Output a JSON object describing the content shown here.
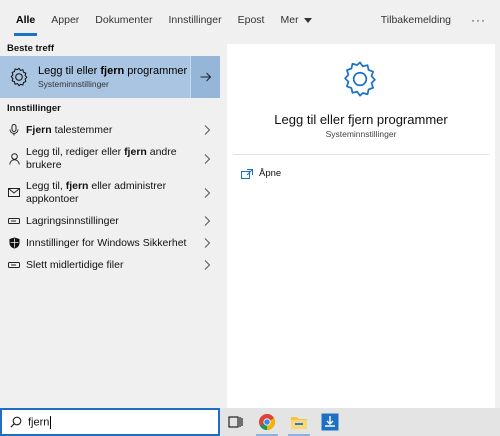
{
  "tabs": [
    {
      "label": "Alle",
      "active": true
    },
    {
      "label": "Apper"
    },
    {
      "label": "Dokumenter"
    },
    {
      "label": "Innstillinger"
    },
    {
      "label": "Epost"
    },
    {
      "label": "Mer"
    }
  ],
  "header": {
    "feedback": "Tilbakemelding",
    "more": "···"
  },
  "best_match": {
    "heading": "Beste treff",
    "title": "Legg til eller fjern programmer",
    "subtitle": "Systeminnstillinger"
  },
  "settings_section": {
    "heading": "Innstillinger",
    "items": [
      {
        "label": "Fjern talestemmer",
        "icon": "microphone-icon"
      },
      {
        "label": "Legg til, rediger eller fjern andre brukere",
        "icon": "person-icon"
      },
      {
        "label": "Legg til, fjern eller administrer appkontoer",
        "icon": "mail-icon"
      },
      {
        "label": "Lagringsinnstillinger",
        "icon": "storage-icon"
      },
      {
        "label": "Innstillinger for Windows Sikkerhet",
        "icon": "shield-icon"
      },
      {
        "label": "Slett midlertidige filer",
        "icon": "storage-icon"
      }
    ]
  },
  "preview": {
    "title": "Legg til eller fjern programmer",
    "subtitle": "Systeminnstillinger",
    "open_label": "Åpne"
  },
  "search": {
    "query": "fjern"
  },
  "colors": {
    "accent": "#1a73c8",
    "selected": "#a9c5e2"
  }
}
